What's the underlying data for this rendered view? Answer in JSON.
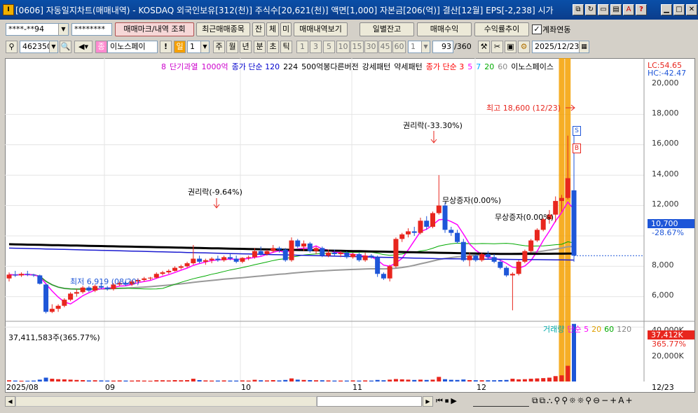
{
  "window": {
    "title": "[0606] 자동일지차트(매매내역) - KOSDAQ 외국인보유[312(천)] 주식수[20,621(천)] 액면[1,000] 자본금[206(억)] 결산[12월] EPS[-2,238] 시가"
  },
  "toolbar1": {
    "account_value": "****-**94",
    "password_value": "********",
    "trade_mark_label": "매매마크/내역 조회",
    "recent_trades_label": "최근매매종목",
    "filter_jan": "잔",
    "filter_che": "체",
    "filter_mi": "미",
    "trade_history_label": "매매내역보기",
    "daily_balance_label": "일별잔고",
    "trade_profit_label": "매매수익",
    "return_trend_label": "수익률추이",
    "account_link_label": "계좌연동"
  },
  "toolbar2": {
    "stock_code": "462350",
    "stock_name": "이노스페이",
    "period_selected": "일",
    "period_value": "1",
    "periods": [
      "주",
      "월",
      "년",
      "분",
      "초",
      "틱"
    ],
    "intervals": [
      "1",
      "3",
      "5",
      "10",
      "15",
      "30",
      "45",
      "60"
    ],
    "interval_value": "1",
    "count_value": "93",
    "count_total": "/360",
    "date_value": "2025/12/23"
  },
  "chart": {
    "legend": [
      {
        "text": "8",
        "color": "#cc00cc"
      },
      {
        "text": "단기과열",
        "color": "#cc00cc"
      },
      {
        "text": "1000억",
        "color": "#cc00cc"
      },
      {
        "text": "종가 단순 120",
        "color": "#0000cc"
      },
      {
        "text": "224",
        "color": "#000000"
      },
      {
        "text": "500억봉다른버전",
        "color": "#000000"
      },
      {
        "text": "강세패턴",
        "color": "#000000"
      },
      {
        "text": "약세패턴",
        "color": "#000000"
      },
      {
        "text": "종가 단순 3",
        "color": "#ff0000"
      },
      {
        "text": "5",
        "color": "#ff00ff"
      },
      {
        "text": "7",
        "color": "#00aaff"
      },
      {
        "text": "20",
        "color": "#00aa00"
      },
      {
        "text": "60",
        "color": "#888888"
      },
      {
        "text": "이노스페이스",
        "color": "#000000"
      }
    ],
    "lc_label": "LC:54.65",
    "hc_label": "HC:-42.47",
    "price_axis": [
      "20,000",
      "18,000",
      "16,000",
      "14,000",
      "12,000",
      "10,000",
      "8,000",
      "6,000"
    ],
    "current_price": "10,700",
    "current_pct": "-28.67%",
    "date_axis": [
      "2025/08",
      "09",
      "10",
      "11",
      "12",
      "12/23"
    ],
    "ann_high": "최고 18,600 (12/23)",
    "ann_rights1": "권리락(-33.30%)",
    "ann_rights2": "권리락(-9.64%)",
    "ann_bonus1": "무상증자(0.00%)",
    "ann_bonus2": "무상증자(0.00%)",
    "ann_low": "최저 6,919 (08/20)",
    "marker_s": "S",
    "marker_b": "B",
    "volume_info": "37,411,583주(365.77%)",
    "volume_legend": [
      {
        "text": "거래량",
        "color": "#00aaaa"
      },
      {
        "text": "단순 5",
        "color": "#ff00ff"
      },
      {
        "text": "20",
        "color": "#e0a000"
      },
      {
        "text": "60",
        "color": "#00aa00"
      },
      {
        "text": "120",
        "color": "#888888"
      }
    ],
    "volume_axis": [
      "40,000K",
      "20,000K"
    ],
    "volume_current": "37,412K",
    "volume_pct": "365.77%"
  },
  "colors": {
    "up": "#e8261e",
    "down": "#1e56d8",
    "ma120": "#1a1ad0",
    "ma224": "#000000",
    "highlight": "#f5a000"
  },
  "candles": [
    [
      9200,
      9600,
      9000,
      9450
    ],
    [
      9450,
      9700,
      9300,
      9400
    ],
    [
      9400,
      9600,
      9300,
      9500
    ],
    [
      9500,
      9700,
      9350,
      9450
    ],
    [
      9450,
      9500,
      9300,
      9400
    ],
    [
      9400,
      9450,
      8800,
      8850
    ],
    [
      8800,
      8850,
      6900,
      7000
    ],
    [
      7000,
      7500,
      6919,
      7200
    ],
    [
      7200,
      7500,
      7000,
      7400
    ],
    [
      7400,
      7900,
      7300,
      7800
    ],
    [
      7800,
      8300,
      7700,
      8200
    ],
    [
      8200,
      8500,
      8000,
      8300
    ],
    [
      8300,
      8700,
      8200,
      8600
    ],
    [
      8600,
      8700,
      8300,
      8400
    ],
    [
      8400,
      8800,
      8300,
      8700
    ],
    [
      8700,
      8900,
      8500,
      8600
    ],
    [
      8600,
      8700,
      8400,
      8500
    ],
    [
      8500,
      8900,
      8400,
      8800
    ],
    [
      8800,
      9000,
      8700,
      8900
    ],
    [
      8900,
      9000,
      8700,
      8800
    ],
    [
      8800,
      9100,
      8700,
      9000
    ],
    [
      9000,
      9200,
      8800,
      9100
    ],
    [
      9100,
      9300,
      9000,
      9200
    ],
    [
      9200,
      9300,
      9100,
      9250
    ],
    [
      9250,
      9600,
      9200,
      9500
    ],
    [
      9500,
      9700,
      9400,
      9600
    ],
    [
      9600,
      9800,
      9500,
      9700
    ],
    [
      9700,
      10000,
      9650,
      9900
    ],
    [
      9900,
      10100,
      9800,
      10000
    ],
    [
      10000,
      10300,
      9900,
      10200
    ],
    [
      10200,
      11400,
      10100,
      10500
    ],
    [
      10500,
      10700,
      10200,
      10300
    ],
    [
      10300,
      10500,
      10100,
      10400
    ],
    [
      10400,
      10600,
      10200,
      10500
    ],
    [
      10500,
      10700,
      10300,
      10400
    ],
    [
      10400,
      10700,
      10300,
      10600
    ],
    [
      10600,
      10800,
      10400,
      10500
    ],
    [
      10500,
      10700,
      10200,
      10300
    ],
    [
      10300,
      10600,
      10200,
      10550
    ],
    [
      10550,
      10700,
      10400,
      10600
    ],
    [
      10600,
      11200,
      10500,
      11000
    ],
    [
      11000,
      11300,
      10700,
      10800
    ],
    [
      10800,
      11100,
      10700,
      11000
    ],
    [
      11000,
      11400,
      10900,
      11200
    ],
    [
      11200,
      11300,
      10900,
      11100
    ],
    [
      11100,
      11200,
      10300,
      10400
    ],
    [
      10400,
      11900,
      10300,
      11700
    ],
    [
      11700,
      11800,
      11200,
      11300
    ],
    [
      11300,
      11700,
      11000,
      11500
    ],
    [
      11500,
      11600,
      10900,
      11000
    ],
    [
      11000,
      11300,
      10800,
      11200
    ],
    [
      11200,
      11300,
      10600,
      10700
    ],
    [
      10700,
      11100,
      10600,
      10900
    ],
    [
      10900,
      11100,
      10700,
      10800
    ],
    [
      10800,
      11000,
      10600,
      10900
    ],
    [
      10900,
      11000,
      10500,
      10600
    ],
    [
      10600,
      10900,
      10500,
      10800
    ],
    [
      10800,
      10900,
      10300,
      10400
    ],
    [
      10400,
      10900,
      10300,
      10700
    ],
    [
      10700,
      10800,
      10500,
      10600
    ],
    [
      10600,
      10700,
      9300,
      9500
    ],
    [
      9500,
      9600,
      9100,
      9200
    ],
    [
      9200,
      10100,
      9000,
      10000
    ],
    [
      10000,
      11900,
      9900,
      11800
    ],
    [
      11800,
      12200,
      11600,
      12100
    ],
    [
      12100,
      12500,
      11900,
      12300
    ],
    [
      12300,
      12600,
      12000,
      12200
    ],
    [
      12200,
      13200,
      12100,
      13000
    ],
    [
      13000,
      13300,
      12400,
      12600
    ],
    [
      12600,
      13600,
      12500,
      13500
    ],
    [
      13500,
      16000,
      13400,
      14000
    ],
    [
      14000,
      14200,
      12200,
      12400
    ],
    [
      12400,
      12600,
      12000,
      12200
    ],
    [
      12200,
      12400,
      11500,
      11600
    ],
    [
      11600,
      11800,
      10300,
      10400
    ],
    [
      10400,
      10900,
      10000,
      10700
    ],
    [
      10700,
      10800,
      10300,
      10400
    ],
    [
      10400,
      10900,
      10300,
      10800
    ],
    [
      10800,
      11000,
      10500,
      10600
    ],
    [
      10600,
      10800,
      10200,
      10300
    ],
    [
      10300,
      10500,
      9800,
      9900
    ],
    [
      9900,
      10000,
      9300,
      9400
    ],
    [
      9400,
      9600,
      7100,
      9500
    ],
    [
      9500,
      10400,
      9400,
      10300
    ],
    [
      10300,
      11100,
      10200,
      11000
    ],
    [
      11000,
      11800,
      10900,
      11700
    ],
    [
      11700,
      12500,
      11600,
      12400
    ],
    [
      12400,
      13200,
      12300,
      13100
    ],
    [
      13100,
      13700,
      12800,
      13400
    ],
    [
      13400,
      14600,
      12900,
      14300
    ],
    [
      14300,
      14700,
      13600,
      14500
    ],
    [
      14500,
      18600,
      14400,
      15800
    ],
    [
      15000,
      18600,
      10300,
      10700
    ]
  ],
  "volumes": [
    0.8,
    0.6,
    0.5,
    0.5,
    0.6,
    1.2,
    2.5,
    1.8,
    1.5,
    1.4,
    1.2,
    1.0,
    0.9,
    0.7,
    0.8,
    0.7,
    0.6,
    0.6,
    0.7,
    0.6,
    0.6,
    0.7,
    0.6,
    0.5,
    0.8,
    0.8,
    0.7,
    0.9,
    0.8,
    0.9,
    1.8,
    0.9,
    0.7,
    0.6,
    0.6,
    0.7,
    0.6,
    0.6,
    0.7,
    0.6,
    1.1,
    0.8,
    0.7,
    0.9,
    0.7,
    1.0,
    2.0,
    1.2,
    1.0,
    0.9,
    0.8,
    0.8,
    0.7,
    0.6,
    0.6,
    0.6,
    0.7,
    0.6,
    0.7,
    0.6,
    1.0,
    0.8,
    1.2,
    1.6,
    1.4,
    1.2,
    1.0,
    1.2,
    1.0,
    1.2,
    3.0,
    1.5,
    1.1,
    1.0,
    1.3,
    0.9,
    0.8,
    0.8,
    0.8,
    0.8,
    0.9,
    1.0,
    1.8,
    1.4,
    1.5,
    1.8,
    2.0,
    2.2,
    2.5,
    3.5,
    4.0,
    10.2,
    37.4
  ]
}
